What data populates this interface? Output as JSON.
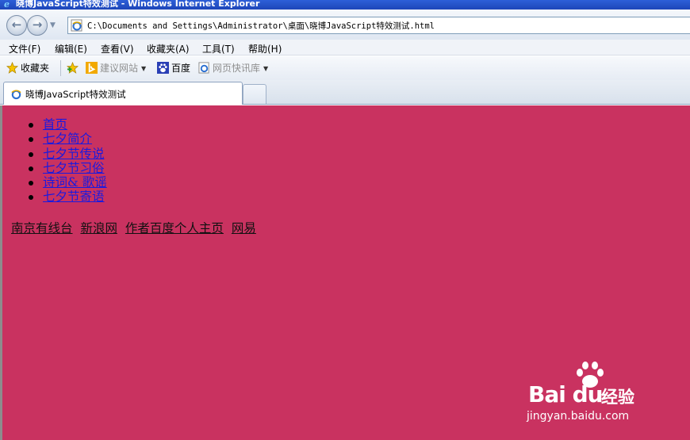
{
  "window": {
    "title": "晓博JavaScript特效测试 - Windows Internet Explorer"
  },
  "address": {
    "url": "C:\\Documents and Settings\\Administrator\\桌面\\晓博JavaScript特效测试.html"
  },
  "menu": {
    "items": [
      "文件(F)",
      "编辑(E)",
      "查看(V)",
      "收藏夹(A)",
      "工具(T)",
      "帮助(H)"
    ]
  },
  "favorites": {
    "favorites_label": "收藏夹",
    "suggested_sites": "建议网站",
    "baidu": "百度",
    "web_slice": "网页快讯库"
  },
  "tab": {
    "title": "晓博JavaScript特效测试"
  },
  "page": {
    "bg_color": "#c93260",
    "nav_items": [
      "首页",
      "七夕简介",
      "七夕节传说",
      "七夕节习俗",
      "诗词& 歌谣",
      "七夕节寄语"
    ],
    "links": [
      "南京有线台",
      "新浪网",
      "作者百度个人主页",
      "网易"
    ]
  },
  "watermark": {
    "brand": "Bai du",
    "cn": "经验",
    "url": "jingyan.baidu.com"
  },
  "colors": {
    "title_bar": "#1d46b8",
    "link_blue": "#1a1adf"
  }
}
